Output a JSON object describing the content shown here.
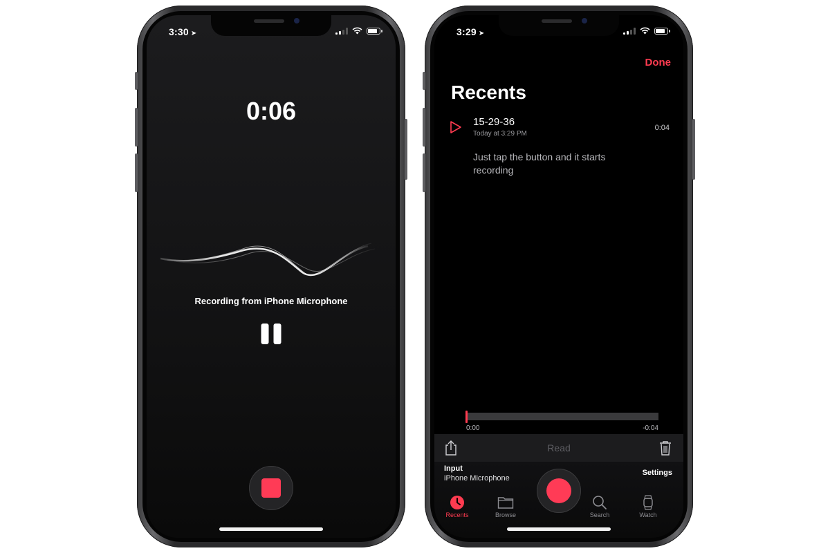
{
  "left_phone": {
    "status_time": "3:30",
    "timer": "0:06",
    "recording_source": "Recording from iPhone Microphone"
  },
  "right_phone": {
    "status_time": "3:29",
    "done_label": "Done",
    "title": "Recents",
    "recording": {
      "name": "15-29-36",
      "date": "Today at 3:29 PM",
      "duration": "0:04",
      "note": "Just tap the button and it starts recording"
    },
    "scrubber": {
      "start": "0:00",
      "end": "-0:04",
      "progress": 0.0
    },
    "action_bar": {
      "read_label": "Read"
    },
    "input": {
      "label": "Input",
      "value": "iPhone Microphone"
    },
    "settings_label": "Settings",
    "tabs": [
      {
        "label": "Recents",
        "icon": "clock-icon",
        "active": true
      },
      {
        "label": "Browse",
        "icon": "folder-icon",
        "active": false
      },
      {
        "label": "Search",
        "icon": "search-icon",
        "active": false
      },
      {
        "label": "Watch",
        "icon": "watch-icon",
        "active": false
      }
    ]
  },
  "colors": {
    "accent_red": "#ff3b50",
    "record_red": "#ff3b56",
    "background": "#000000"
  }
}
